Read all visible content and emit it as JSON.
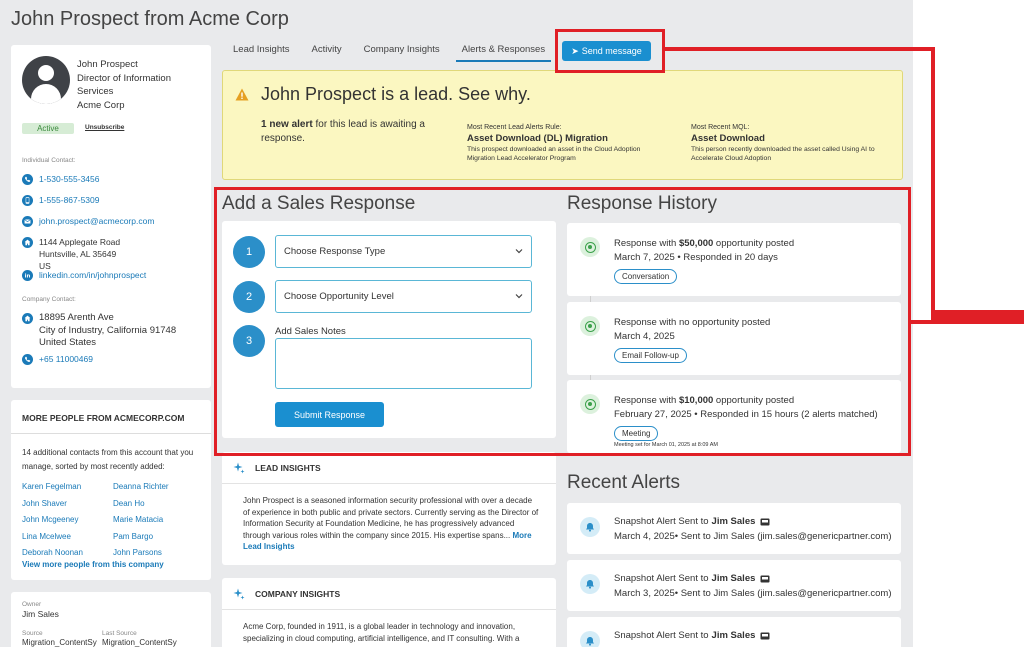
{
  "page": {
    "title": "John Prospect from Acme Corp"
  },
  "profile": {
    "name": "John Prospect",
    "job_title": "Director of Information Services",
    "company": "Acme Corp",
    "status": "Active",
    "unsubscribe": "Unsubscribe",
    "individual_label": "Individual Contact:",
    "phone1": "1-530-555-3456",
    "phone2": "1-555-867-5309",
    "email": "john.prospect@acmecorp.com",
    "address_line1": "1144 Applegate Road",
    "address_line2": "Huntsville, AL 35649",
    "address_line3": "US",
    "linkedin": "linkedin.com/in/johnprospect",
    "company_label": "Company Contact:",
    "company_address_line1": "18895 Arenth Ave",
    "company_address_line2": "City of Industry, California 91748",
    "company_address_line3": "United States",
    "company_phone": "+65 11000469"
  },
  "people": {
    "title": "MORE PEOPLE FROM ACMECORP.COM",
    "description": "14 additional contacts from this account that you manage, sorted by most recently added:",
    "names": [
      "Karen Fegelman",
      "Deanna Richter",
      "John Shaver",
      "Dean Ho",
      "John Mcgeeney",
      "Marie Matacia",
      "Lina Mcelwee",
      "Pam Bargo",
      "Deborah Noonan",
      "John Parsons"
    ],
    "view_more": "View more people from this company"
  },
  "owner": {
    "label": "Owner",
    "value": "Jim Sales",
    "source_label": "Source",
    "source_value": "Migration_ContentSy",
    "last_source_label": "Last Source",
    "last_source_value": "Migration_ContentSy"
  },
  "tabs": [
    "Lead Insights",
    "Activity",
    "Company Insights",
    "Alerts & Responses"
  ],
  "send_message": "Send message",
  "banner": {
    "headline": "John Prospect is a lead. See why.",
    "alert_bold": "1 new alert",
    "alert_rest": " for this lead is awaiting a response.",
    "rule_label": "Most Recent Lead Alerts Rule:",
    "rule_value": "Asset Download (DL) Migration",
    "rule_desc": "This prospect downloaded an asset in the Cloud Adoption Migration Lead Accelerator Program",
    "mql_label": "Most Recent MQL:",
    "mql_value": "Asset Download",
    "mql_desc": "This person recently downloaded the asset called Using AI to Accelerate Cloud Adoption"
  },
  "sales_response": {
    "title": "Add a Sales Response",
    "step1": "1",
    "step2": "2",
    "step3": "3",
    "response_type": "Choose Response Type",
    "opportunity_level": "Choose Opportunity Level",
    "notes_label": "Add Sales Notes",
    "submit": "Submit Response"
  },
  "lead_insights": {
    "title": "LEAD INSIGHTS",
    "body": "John Prospect is a seasoned information security professional with over a decade of experience in both public and private sectors. Currently serving as the Director of Information Security at Foundation Medicine, he has progressively advanced through various roles within the company since 2015. His expertise spans... ",
    "more": "More Lead Insights"
  },
  "company_insights": {
    "title": "COMPANY INSIGHTS",
    "body": "Acme Corp, founded in 1911, is a global leader in technology and innovation, specializing in cloud computing, artificial intelligence, and IT consulting. With a"
  },
  "history": {
    "title": "Response History",
    "items": [
      {
        "pre": "Response with ",
        "bold": "$50,000",
        "post": " opportunity posted",
        "line2": "March 7, 2025 • Responded in 20 days",
        "tag": "Conversation",
        "note": ""
      },
      {
        "pre": "Response with no opportunity posted",
        "bold": "",
        "post": "",
        "line2": "March 4, 2025",
        "tag": "Email Follow-up",
        "note": ""
      },
      {
        "pre": "Response with ",
        "bold": "$10,000",
        "post": " opportunity posted",
        "line2": "February 27, 2025 • Responded in 15 hours (2 alerts matched)",
        "tag": "Meeting",
        "note": "Meeting set for March 01, 2025 at 8:09 AM"
      }
    ]
  },
  "alerts": {
    "title": "Recent Alerts",
    "items": [
      {
        "pre": "Snapshot Alert Sent to",
        "name": "Jim Sales",
        "line2": "March 4, 2025• Sent to Jim Sales (jim.sales@genericpartner.com)"
      },
      {
        "pre": "Snapshot Alert Sent to",
        "name": "Jim Sales",
        "line2": "March 3, 2025• Sent to Jim Sales (jim.sales@genericpartner.com)"
      },
      {
        "pre": "Snapshot Alert Sent to",
        "name": "Jim Sales",
        "line2": ""
      }
    ]
  },
  "colors": {
    "accent": "#1a8fd0",
    "annotation_red": "#e01f26",
    "banner_bg": "#fbf7c1",
    "success_green": "#3aa04a"
  }
}
